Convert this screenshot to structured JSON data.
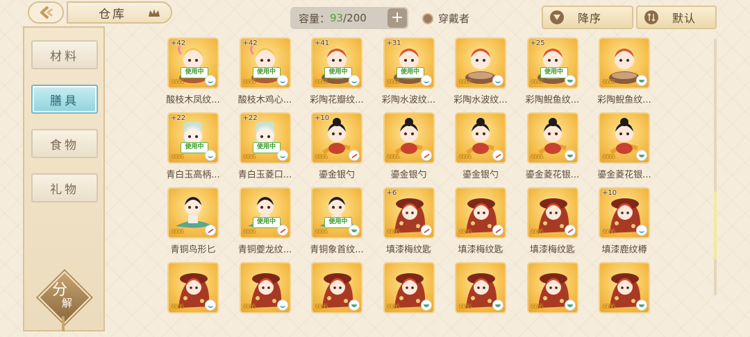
{
  "header": {
    "title": "仓库",
    "capacity_label": "容量：",
    "capacity_current": "93",
    "capacity_max": "/200",
    "add_label": "+",
    "wearer_label": "穿戴者",
    "sort_order_label": "降序",
    "sort_mode_label": "默认"
  },
  "sidebar": {
    "items": [
      {
        "label": "材料",
        "active": false
      },
      {
        "label": "膳具",
        "active": true
      },
      {
        "label": "食物",
        "active": false
      },
      {
        "label": "礼物",
        "active": false
      }
    ],
    "decompose_char1": "分",
    "decompose_char2": "解"
  },
  "items": [
    {
      "name": "酸枝木凤纹...",
      "level": "+42",
      "in_use": "使用中",
      "badge": "tea",
      "art": "girl-pink"
    },
    {
      "name": "酸枝木鸡心...",
      "level": "+42",
      "in_use": "使用中",
      "badge": "tea",
      "art": "girl-pink"
    },
    {
      "name": "彩陶花瓣纹...",
      "level": "+41",
      "in_use": "使用中",
      "badge": "tea",
      "art": "boy-red"
    },
    {
      "name": "彩陶水波纹...",
      "level": "+31",
      "in_use": "使用中",
      "badge": "tea",
      "art": "boy-red"
    },
    {
      "name": "彩陶水波纹...",
      "level": "",
      "in_use": "",
      "badge": "tea",
      "art": "boy-red"
    },
    {
      "name": "彩陶鲵鱼纹...",
      "level": "+25",
      "in_use": "使用中",
      "badge": "bowl",
      "art": "boy-red"
    },
    {
      "name": "彩陶鲵鱼纹...",
      "level": "",
      "in_use": "",
      "badge": "bowl",
      "art": "boy-red"
    },
    {
      "name": "青白玉高柄...",
      "level": "+22",
      "in_use": "使用中",
      "badge": "tea",
      "art": "jade"
    },
    {
      "name": "青白玉菱口...",
      "level": "+22",
      "in_use": "使用中",
      "badge": "tea",
      "art": "jade"
    },
    {
      "name": "鎏金银勺",
      "level": "+10",
      "in_use": "",
      "badge": "spoon",
      "art": "girl-black"
    },
    {
      "name": "鎏金银勺",
      "level": "",
      "in_use": "",
      "badge": "spoon",
      "art": "girl-black"
    },
    {
      "name": "鎏金银勺",
      "level": "",
      "in_use": "",
      "badge": "spoon",
      "art": "girl-black"
    },
    {
      "name": "鎏金菱花银...",
      "level": "",
      "in_use": "",
      "badge": "bowl",
      "art": "girl-black"
    },
    {
      "name": "鎏金菱花银...",
      "level": "",
      "in_use": "",
      "badge": "bowl",
      "art": "girl-black"
    },
    {
      "name": "青铜鸟形匕",
      "level": "",
      "in_use": "",
      "badge": "spoon",
      "art": "boy-green"
    },
    {
      "name": "青铜夔龙纹...",
      "level": "",
      "in_use": "使用中",
      "badge": "spoon",
      "art": "boy-green"
    },
    {
      "name": "青铜象首纹...",
      "level": "",
      "in_use": "使用中",
      "badge": "bowl",
      "art": "boy-green"
    },
    {
      "name": "填漆梅纹匙",
      "level": "+6",
      "in_use": "",
      "badge": "spoon",
      "art": "girl-red"
    },
    {
      "name": "填漆梅纹匙",
      "level": "",
      "in_use": "",
      "badge": "spoon",
      "art": "girl-red"
    },
    {
      "name": "填漆梅纹匙",
      "level": "",
      "in_use": "",
      "badge": "spoon",
      "art": "girl-red"
    },
    {
      "name": "填漆鹿纹樽",
      "level": "+10",
      "in_use": "",
      "badge": "tea",
      "art": "girl-red"
    },
    {
      "name": "",
      "level": "",
      "in_use": "",
      "badge": "tea",
      "art": "girl-red"
    },
    {
      "name": "",
      "level": "",
      "in_use": "",
      "badge": "tea",
      "art": "girl-red"
    },
    {
      "name": "",
      "level": "",
      "in_use": "",
      "badge": "bowl",
      "art": "girl-red"
    },
    {
      "name": "",
      "level": "",
      "in_use": "",
      "badge": "bowl",
      "art": "girl-red"
    },
    {
      "name": "",
      "level": "",
      "in_use": "",
      "badge": "bowl",
      "art": "girl-red"
    },
    {
      "name": "",
      "level": "",
      "in_use": "",
      "badge": "bowl",
      "art": "girl-red"
    },
    {
      "name": "",
      "level": "",
      "in_use": "",
      "badge": "bowl",
      "art": "girl-red"
    }
  ],
  "rarity_stars": "6666"
}
